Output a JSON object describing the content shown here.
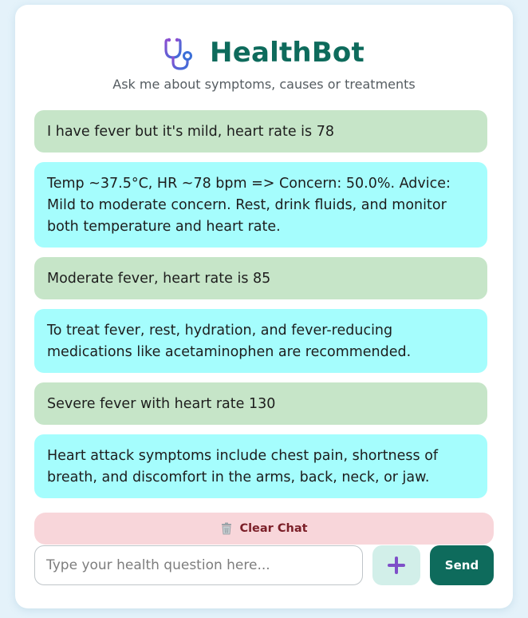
{
  "header": {
    "title": "HealthBot",
    "subtitle": "Ask me about symptoms, causes or treatments",
    "logo_icon": "stethoscope-icon"
  },
  "messages": [
    {
      "role": "user",
      "text": "I have fever but it's mild, heart rate is 78"
    },
    {
      "role": "bot",
      "text": "Temp ~37.5°C, HR ~78 bpm => Concern: 50.0%. Advice: Mild to moderate concern. Rest, drink fluids, and monitor both temperature and heart rate."
    },
    {
      "role": "user",
      "text": "Moderate fever, heart rate is 85"
    },
    {
      "role": "bot",
      "text": "To treat fever, rest, hydration, and fever-reducing medications like acetaminophen are recommended."
    },
    {
      "role": "user",
      "text": "Severe fever with heart rate 130"
    },
    {
      "role": "bot",
      "text": "Heart attack symptoms include chest pain, shortness of breath, and discomfort in the arms, back, neck, or jaw."
    }
  ],
  "controls": {
    "clear_label": "Clear Chat",
    "clear_icon": "trash-icon",
    "input_placeholder": "Type your health question here...",
    "input_value": "",
    "plus_icon": "plus-icon",
    "send_label": "Send"
  },
  "colors": {
    "brand": "#0e6b5c",
    "user_bubble": "#c6e5c8",
    "bot_bubble": "#a5fdfd",
    "clear_bg": "#f8d6da",
    "plus_bg": "#d2efe9",
    "plus_glyph": "#7e4fc8",
    "page_bg": "#e4f2fa"
  }
}
